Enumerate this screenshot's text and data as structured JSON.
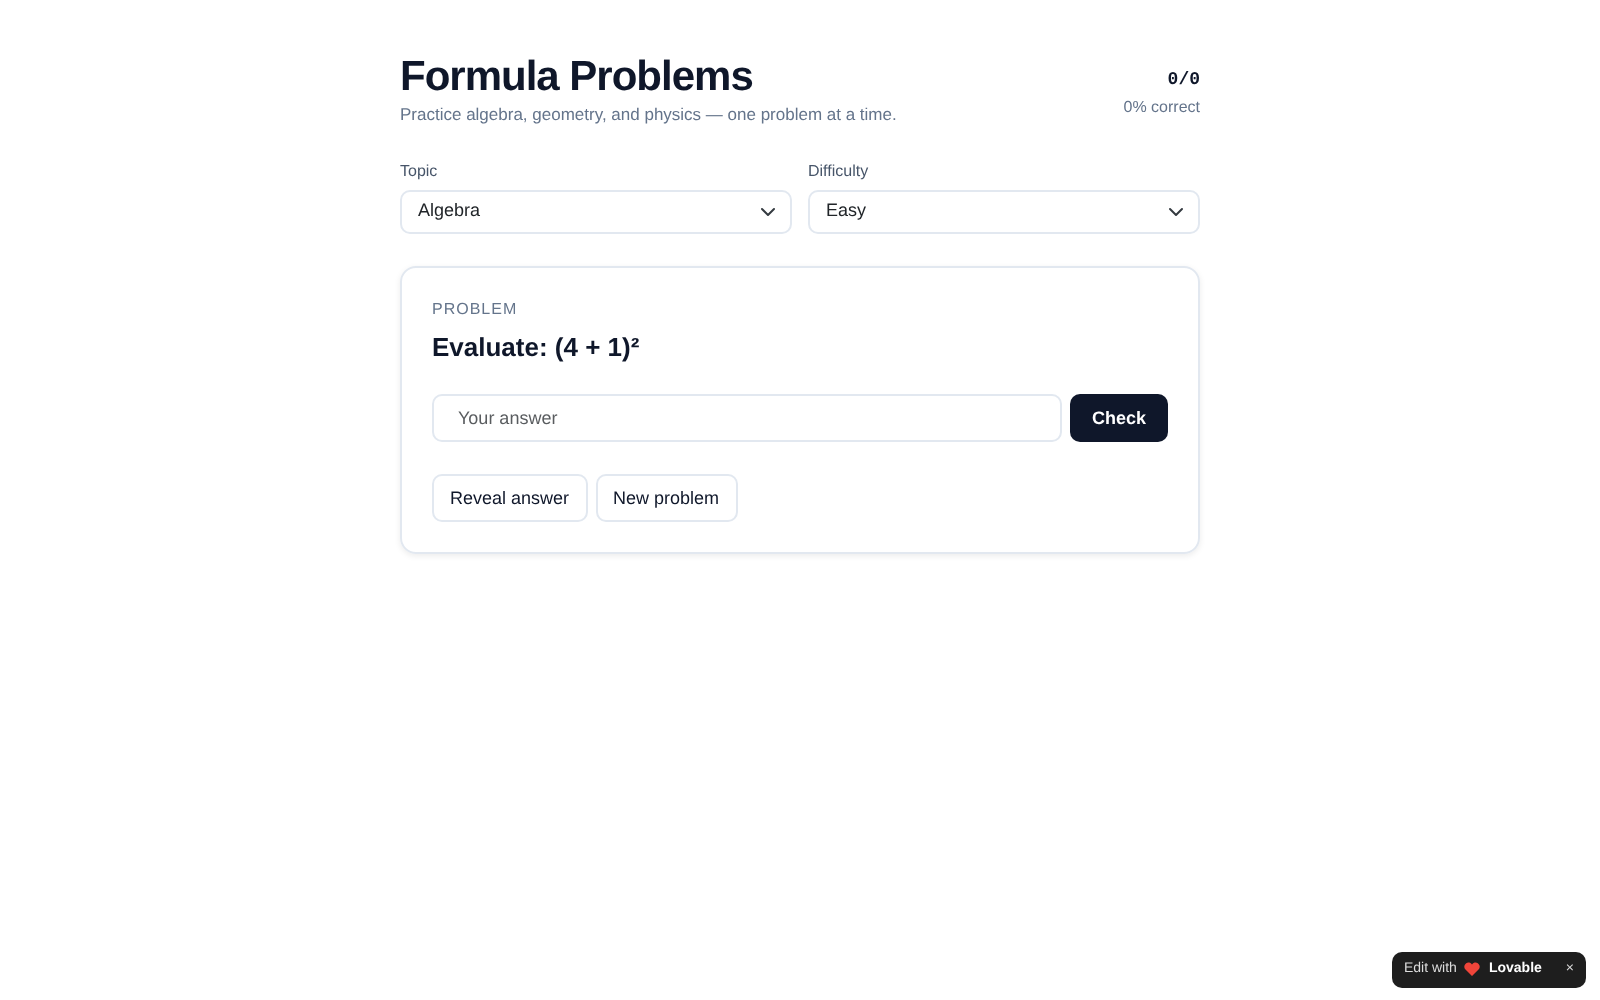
{
  "header": {
    "title": "Formula Problems",
    "subtitle": "Practice algebra, geometry, and physics — one problem at a time.",
    "score": "0/0",
    "accuracy": "0% correct"
  },
  "filters": [
    {
      "label": "Topic",
      "value": "Algebra"
    },
    {
      "label": "Difficulty",
      "value": "Easy"
    }
  ],
  "problem": {
    "label": "PROBLEM",
    "question": "Evaluate: (4 + 1)²",
    "answer": {
      "placeholder": "Your answer"
    },
    "check_button": "Check",
    "buttons": [
      "Reveal answer",
      "New problem"
    ]
  },
  "badge": {
    "text": "Edit with",
    "brand": "Lovable",
    "close": "×"
  }
}
